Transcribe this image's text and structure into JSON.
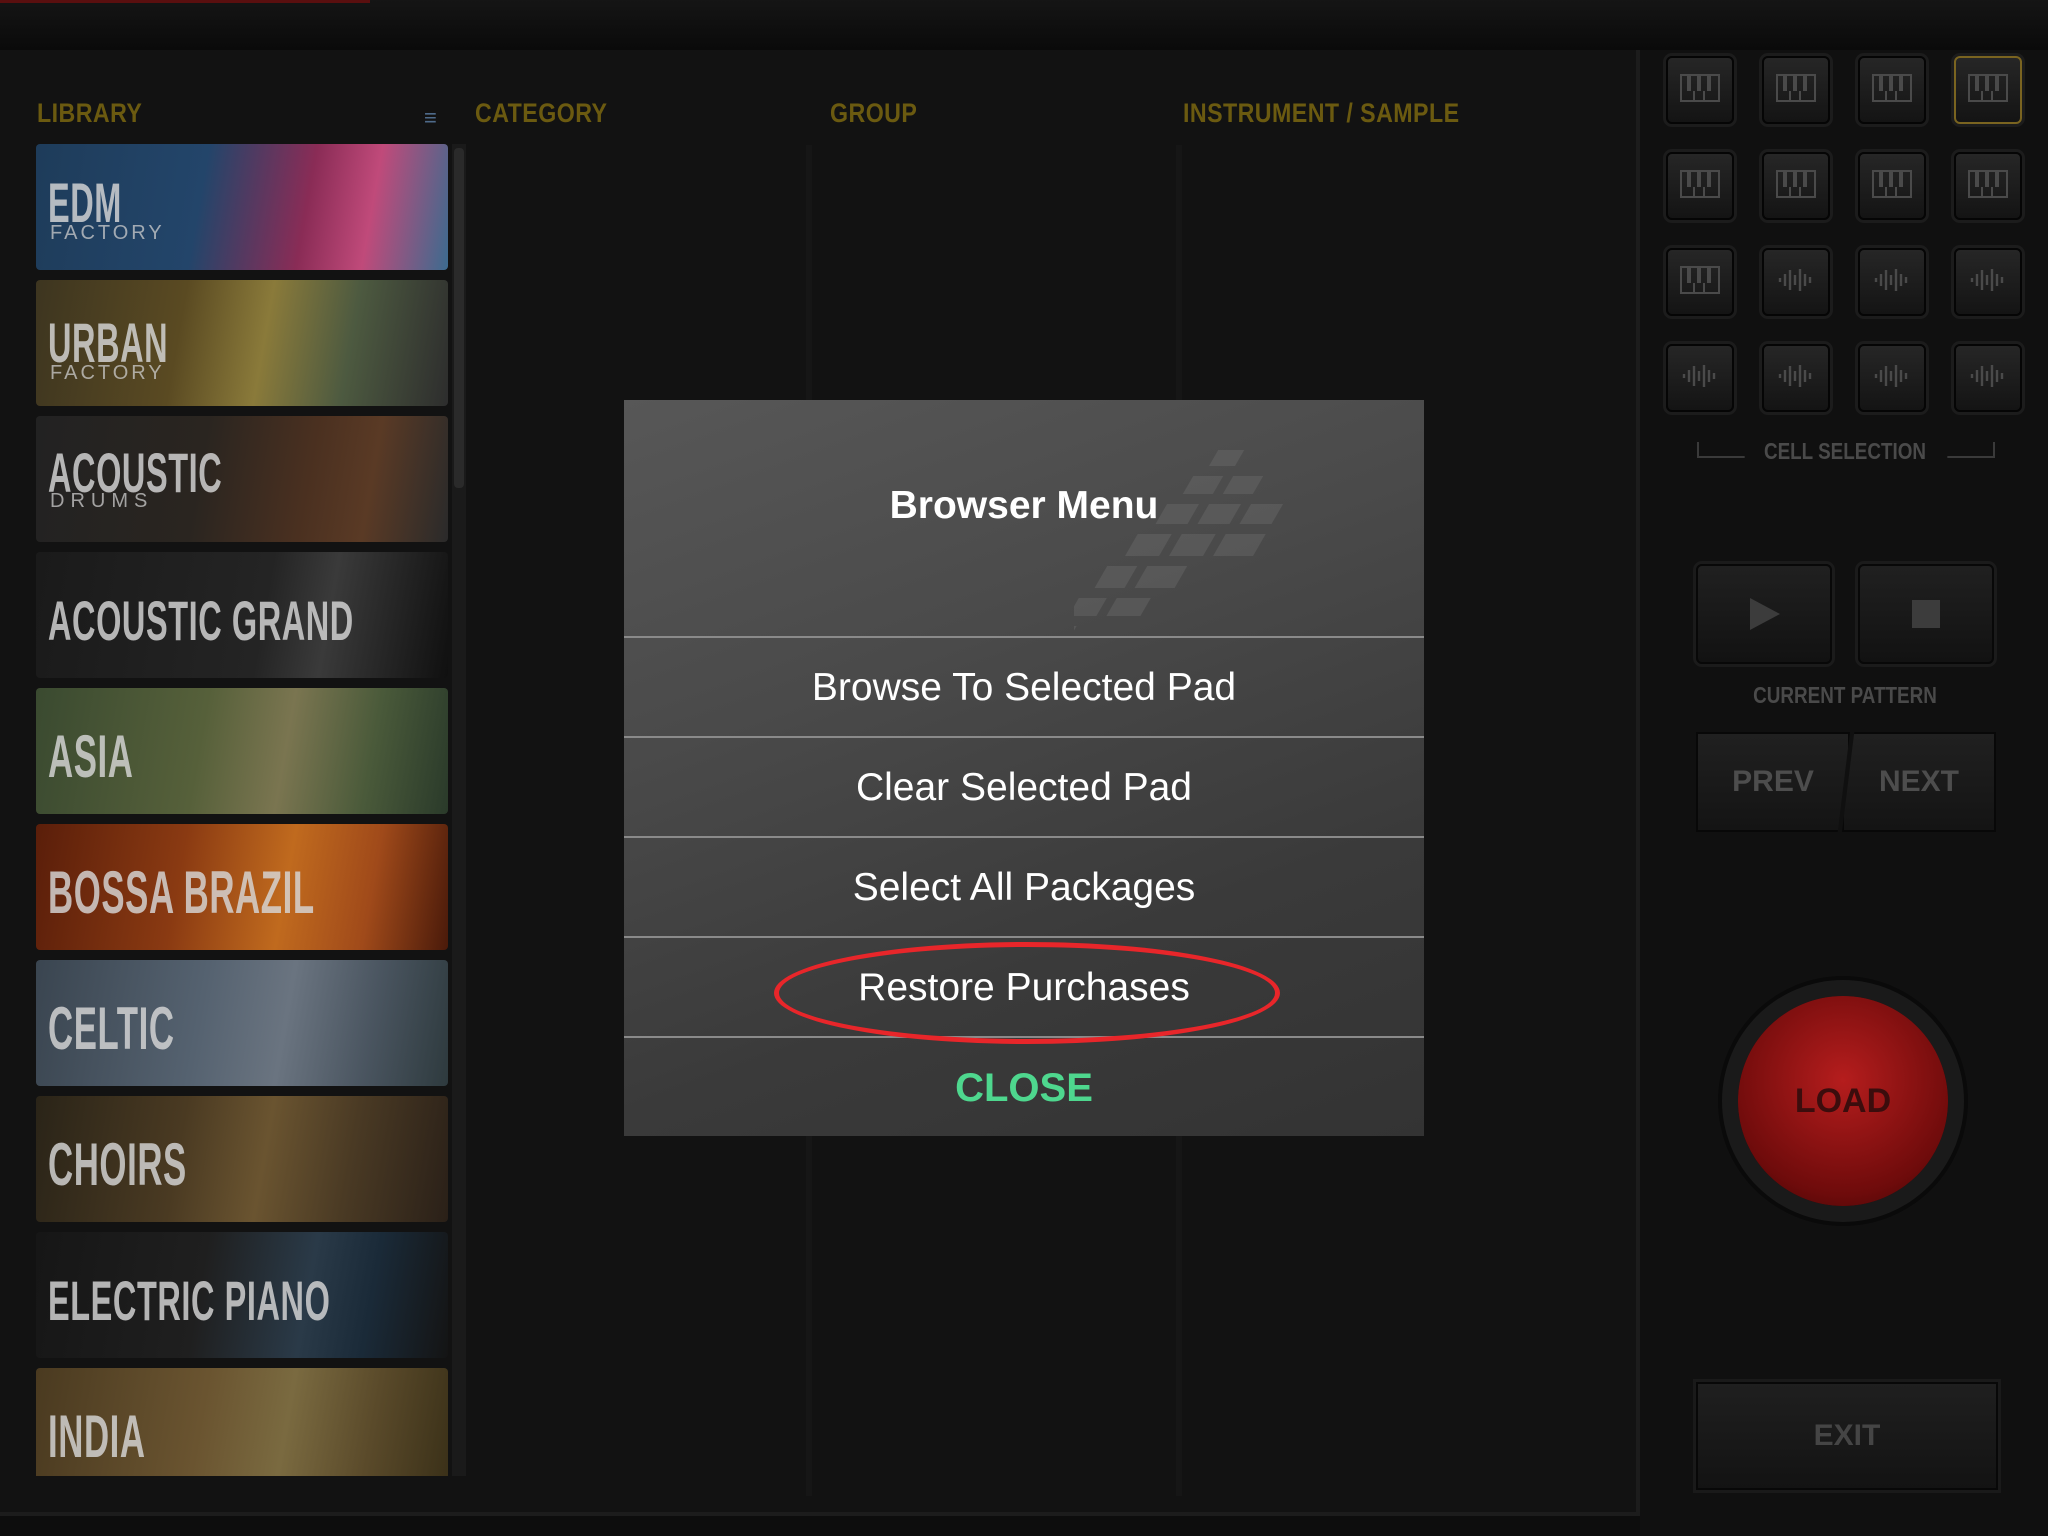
{
  "columns": {
    "library": "LIBRARY",
    "category": "CATEGORY",
    "group": "GROUP",
    "instrument": "INSTRUMENT / SAMPLE"
  },
  "library_items": [
    {
      "name": "EDM",
      "sub": "FACTORY"
    },
    {
      "name": "URBAN",
      "sub": "FACTORY"
    },
    {
      "name": "ACOUSTIC",
      "sub": "DRUMS"
    },
    {
      "name": "ACOUSTIC GRAND",
      "sub": ""
    },
    {
      "name": "ASIA",
      "sub": ""
    },
    {
      "name": "BOSSA BRAZIL",
      "sub": ""
    },
    {
      "name": "CELTIC",
      "sub": ""
    },
    {
      "name": "CHOIRS",
      "sub": ""
    },
    {
      "name": "ELECTRIC PIANO",
      "sub": ""
    },
    {
      "name": "INDIA",
      "sub": ""
    }
  ],
  "right_panel": {
    "cell_selection_label": "CELL SELECTION",
    "current_pattern_label": "CURRENT PATTERN",
    "prev_label": "PREV",
    "next_label": "NEXT",
    "load_label": "LOAD",
    "exit_label": "EXIT",
    "pads": [
      "piano",
      "piano",
      "piano",
      "piano",
      "piano",
      "piano",
      "piano",
      "piano",
      "piano",
      "wave",
      "wave",
      "wave",
      "wave",
      "wave",
      "wave",
      "wave"
    ],
    "selected_pad": 3
  },
  "dialog": {
    "title": "Browser Menu",
    "options": [
      "Browse To Selected Pad",
      "Clear Selected Pad",
      "Select All Packages",
      "Restore Purchases"
    ],
    "close_label": "CLOSE",
    "highlighted_option": "Restore Purchases",
    "highlight_color": "#e8262a",
    "close_color": "#4ed78e"
  },
  "colors": {
    "column_header": "#6b5a10"
  }
}
